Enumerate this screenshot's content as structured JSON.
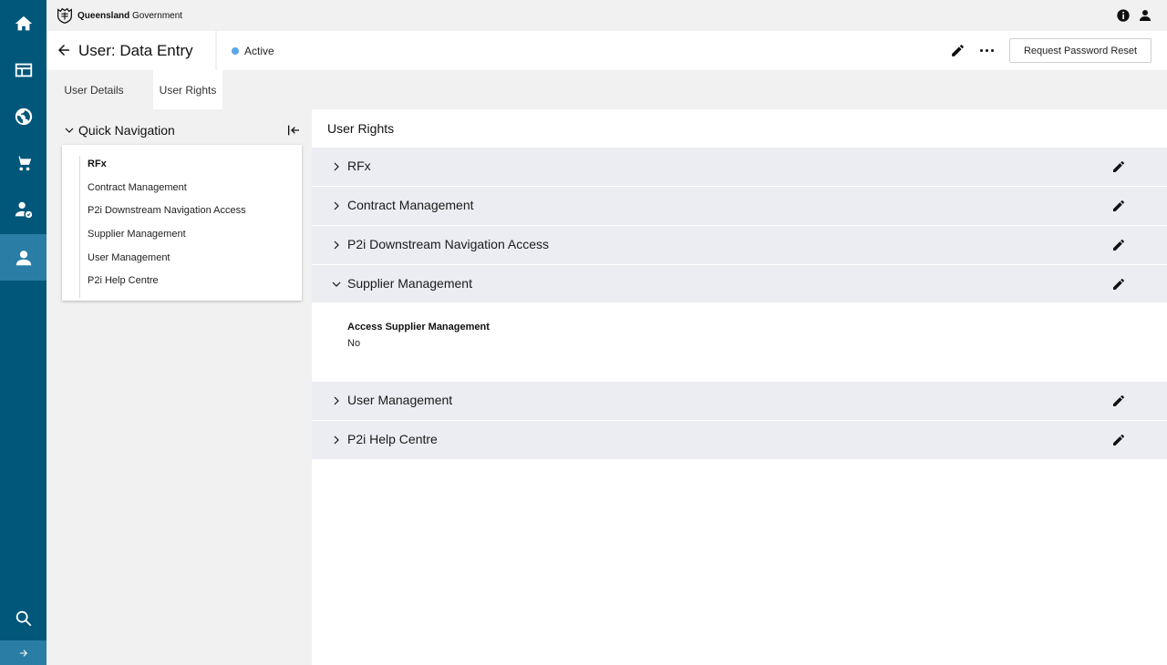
{
  "topbar": {
    "logo_bold": "Queensland",
    "logo_rest": " Government"
  },
  "header": {
    "title": "User: Data Entry",
    "status": "Active",
    "reset_button": "Request Password Reset"
  },
  "tabs": [
    {
      "label": "User Details"
    },
    {
      "label": "User Rights"
    }
  ],
  "quick_nav": {
    "title": "Quick Navigation",
    "items": [
      {
        "label": "RFx"
      },
      {
        "label": "Contract Management"
      },
      {
        "label": "P2i Downstream Navigation Access"
      },
      {
        "label": "Supplier Management"
      },
      {
        "label": "User Management"
      },
      {
        "label": "P2i Help Centre"
      }
    ]
  },
  "main": {
    "title": "User Rights",
    "sections": [
      {
        "label": "RFx"
      },
      {
        "label": "Contract Management"
      },
      {
        "label": "P2i Downstream Navigation Access"
      },
      {
        "label": "Supplier Management"
      },
      {
        "label": "User Management"
      },
      {
        "label": "P2i Help Centre"
      }
    ],
    "expanded_field": {
      "label": "Access Supplier Management",
      "value": "No"
    }
  },
  "colors": {
    "rail": "#005779",
    "rail_active": "#2a7da4",
    "section_bg": "#ebedf2",
    "status_dot": "#5aa6e8"
  }
}
